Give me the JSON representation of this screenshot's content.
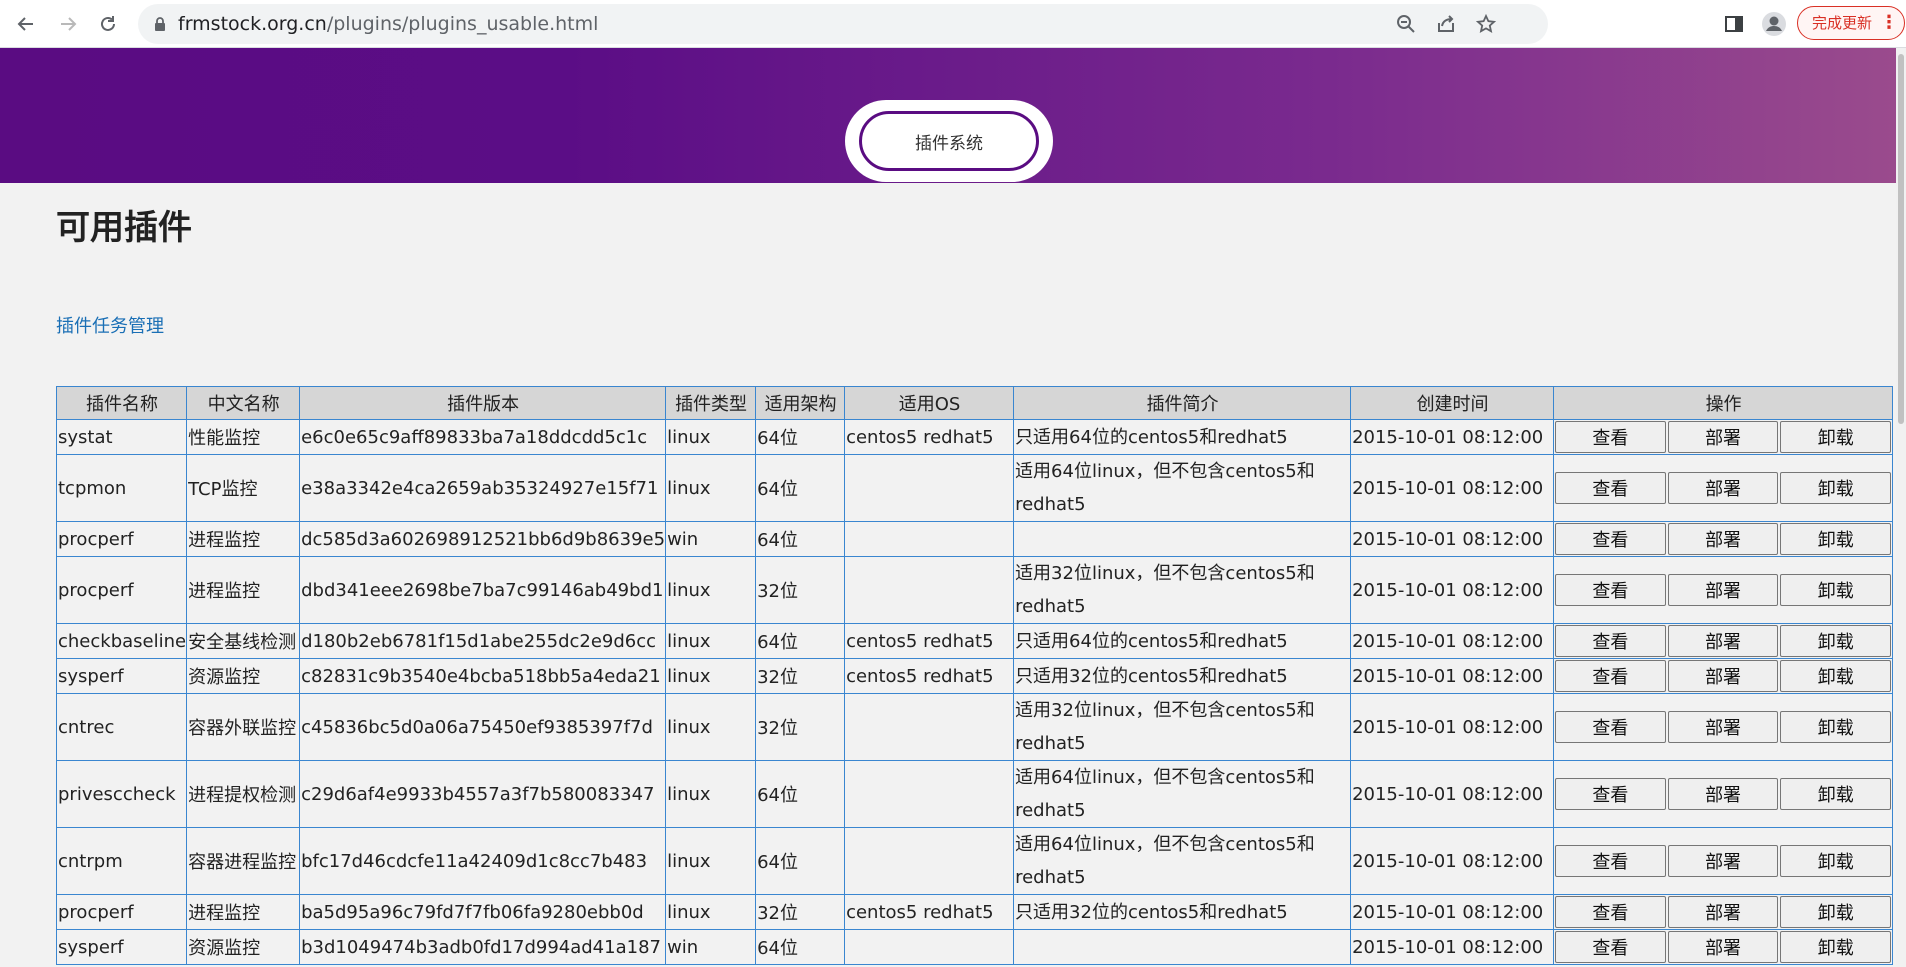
{
  "browser": {
    "url_host": "frmstock.org.cn",
    "url_path": "/plugins/plugins_usable.html",
    "update_label": "完成更新"
  },
  "banner": {
    "title": "插件系统"
  },
  "page": {
    "title": "可用插件",
    "task_link": "插件任务管理"
  },
  "table": {
    "headers": [
      "插件名称",
      "中文名称",
      "插件版本",
      "插件类型",
      "适用架构",
      "适用OS",
      "插件简介",
      "创建时间",
      "操作"
    ],
    "actions": [
      "查看",
      "部署",
      "卸载"
    ],
    "rows": [
      {
        "name": "systat",
        "cn": "性能监控",
        "version": "e6c0e65c9aff89833ba7a18ddcdd5c1c",
        "type": "linux",
        "arch": "64位",
        "os": "centos5 redhat5",
        "desc": "只适用64位的centos5和redhat5",
        "time": "2015-10-01 08:12:00"
      },
      {
        "name": "tcpmon",
        "cn": "TCP监控",
        "version": "e38a3342e4ca2659ab35324927e15f71",
        "type": "linux",
        "arch": "64位",
        "os": "",
        "desc": "适用64位linux，但不包含centos5和redhat5",
        "time": "2015-10-01 08:12:00"
      },
      {
        "name": "procperf",
        "cn": "进程监控",
        "version": "dc585d3a602698912521bb6d9b8639e5",
        "type": "win",
        "arch": "64位",
        "os": "",
        "desc": "",
        "time": "2015-10-01 08:12:00"
      },
      {
        "name": "procperf",
        "cn": "进程监控",
        "version": "dbd341eee2698be7ba7c99146ab49bd1",
        "type": "linux",
        "arch": "32位",
        "os": "",
        "desc": "适用32位linux，但不包含centos5和redhat5",
        "time": "2015-10-01 08:12:00"
      },
      {
        "name": "checkbaseline",
        "cn": "安全基线检测",
        "version": "d180b2eb6781f15d1abe255dc2e9d6cc",
        "type": "linux",
        "arch": "64位",
        "os": "centos5 redhat5",
        "desc": "只适用64位的centos5和redhat5",
        "time": "2015-10-01 08:12:00"
      },
      {
        "name": "sysperf",
        "cn": "资源监控",
        "version": "c82831c9b3540e4bcba518bb5a4eda21",
        "type": "linux",
        "arch": "32位",
        "os": "centos5 redhat5",
        "desc": "只适用32位的centos5和redhat5",
        "time": "2015-10-01 08:12:00"
      },
      {
        "name": "cntrec",
        "cn": "容器外联监控",
        "version": "c45836bc5d0a06a75450ef9385397f7d",
        "type": "linux",
        "arch": "32位",
        "os": "",
        "desc": "适用32位linux，但不包含centos5和redhat5",
        "time": "2015-10-01 08:12:00"
      },
      {
        "name": "privesccheck",
        "cn": "进程提权检测",
        "version": "c29d6af4e9933b4557a3f7b580083347",
        "type": "linux",
        "arch": "64位",
        "os": "",
        "desc": "适用64位linux，但不包含centos5和redhat5",
        "time": "2015-10-01 08:12:00"
      },
      {
        "name": "cntrpm",
        "cn": "容器进程监控",
        "version": "bfc17d46cdcfe11a42409d1c8cc7b483",
        "type": "linux",
        "arch": "64位",
        "os": "",
        "desc": "适用64位linux，但不包含centos5和redhat5",
        "time": "2015-10-01 08:12:00"
      },
      {
        "name": "procperf",
        "cn": "进程监控",
        "version": "ba5d95a96c79fd7f7fb06fa9280ebb0d",
        "type": "linux",
        "arch": "32位",
        "os": "centos5 redhat5",
        "desc": "只适用32位的centos5和redhat5",
        "time": "2015-10-01 08:12:00"
      },
      {
        "name": "sysperf",
        "cn": "资源监控",
        "version": "b3d1049474b3adb0fd17d994ad41a187",
        "type": "win",
        "arch": "64位",
        "os": "",
        "desc": "",
        "time": "2015-10-01 08:12:00"
      }
    ]
  }
}
